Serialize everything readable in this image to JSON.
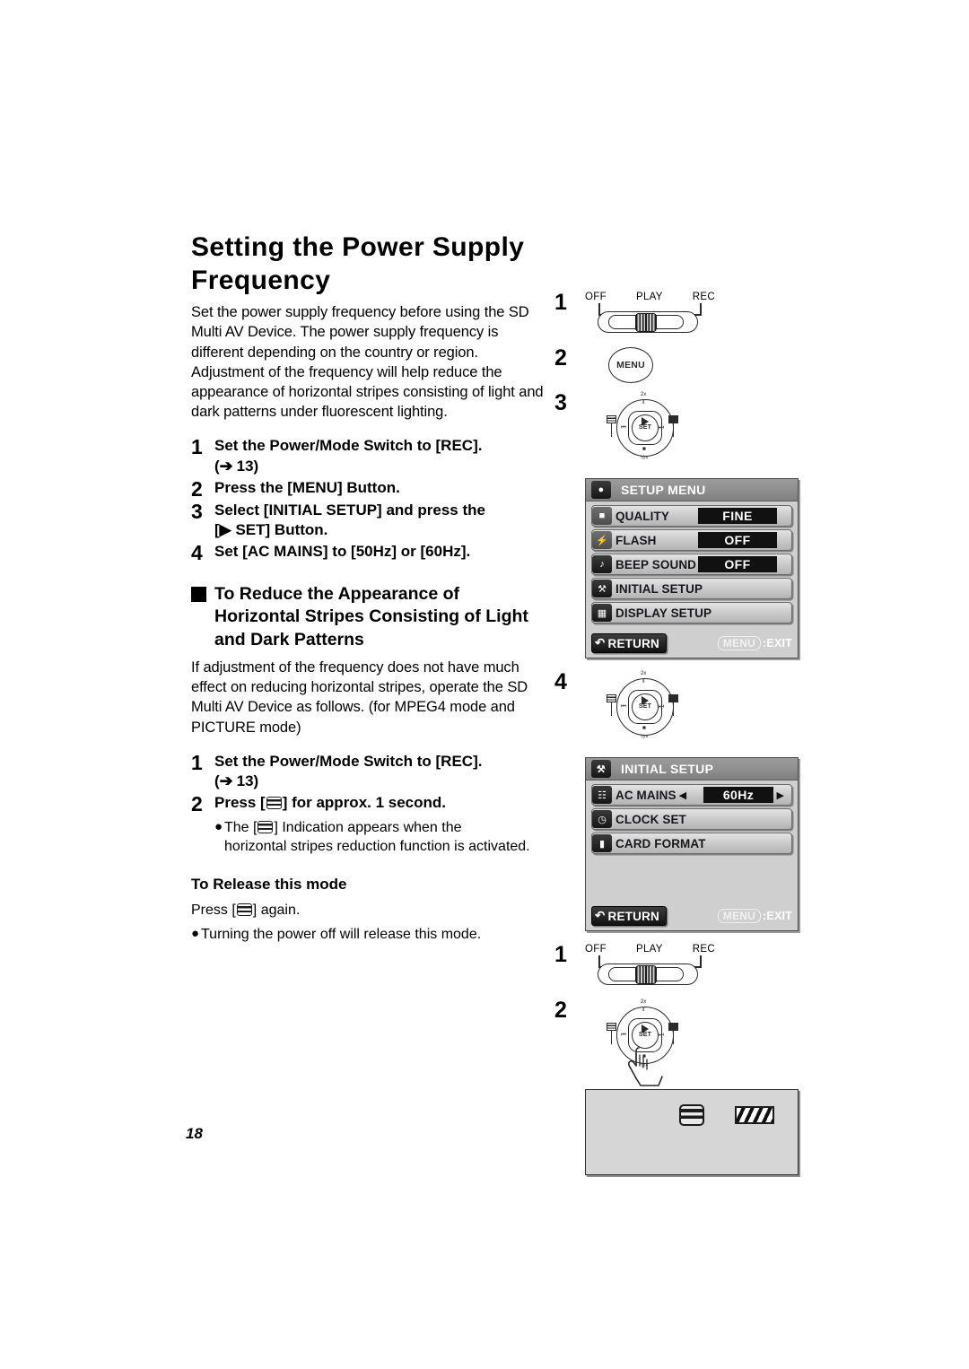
{
  "page": {
    "number": "18"
  },
  "article": {
    "title_line1": "Setting the Power Supply",
    "title_line2": "Frequency",
    "intro": "Set the power supply frequency before using the SD Multi AV Device. The power supply frequency is different depending on the country or region. Adjustment of the frequency will help reduce the appearance of horizontal stripes consisting of light and dark patterns under fluorescent lighting.",
    "steps": [
      {
        "num": "1",
        "text": "Set the Power/Mode Switch to [REC].",
        "sub": "( 13)"
      },
      {
        "num": "2",
        "text": "Press the [MENU] Button.",
        "sub": ""
      },
      {
        "num": "3",
        "text": "Select [INITIAL SETUP] and press the",
        "sub": "[   SET] Button."
      },
      {
        "num": "4",
        "text": "Set [AC MAINS] to [50Hz] or [60Hz].",
        "sub": ""
      }
    ]
  },
  "section": {
    "heading_line1": "To Reduce the Appearance of",
    "heading_line2": "Horizontal Stripes Consisting of Light",
    "heading_line3": "and Dark Patterns",
    "body": "If adjustment of the frequency does not have much effect on reducing horizontal stripes, operate the SD Multi AV Device as follows. (for MPEG4 mode and PICTURE mode)",
    "steps": [
      {
        "num": "1",
        "text": "Set the Power/Mode Switch to [REC].",
        "sub": "( 13)"
      },
      {
        "num": "2",
        "text_before": "Press [",
        "text_after": "] for approx. 1 second.",
        "sub": ""
      }
    ],
    "note_before": "The [",
    "note_after": "]  Indication appears when the",
    "note_line2": "horizontal stripes reduction function is activated.",
    "release_heading": "To Release this mode",
    "release_before": "Press [",
    "release_after": "] again.",
    "release_bullet": "Turning the power off will release this mode."
  },
  "illustrations": {
    "switch": {
      "labels": [
        "OFF",
        "PLAY",
        "REC"
      ]
    },
    "menu_button_label": "MENU",
    "dial": {
      "set_label": "SET",
      "top_label": "2x",
      "bottom_label": "½×",
      "pause_glyph": "‖",
      "stop_glyph": "■",
      "prev_glyph": "⏮",
      "next_glyph": "⏭"
    },
    "step_numbers_col1": [
      "1",
      "2",
      "3",
      "4"
    ],
    "step_numbers_col2": [
      "1",
      "2"
    ]
  },
  "setup_menu": {
    "title": "SETUP MENU",
    "title_icon": "camera-icon",
    "rows": [
      {
        "icon": "quality-icon",
        "label": "QUALITY",
        "value": "FINE"
      },
      {
        "icon": "flash-icon",
        "label": "FLASH",
        "value": "OFF"
      },
      {
        "icon": "beep-icon",
        "label": "BEEP SOUND",
        "value": "OFF"
      },
      {
        "icon": "initial-setup-icon",
        "label": "INITIAL SETUP",
        "value": ""
      },
      {
        "icon": "display-setup-icon",
        "label": "DISPLAY SETUP",
        "value": ""
      }
    ],
    "return_label": "RETURN",
    "exit_key": "MENU",
    "exit_label": ":EXIT"
  },
  "initial_setup_menu": {
    "title": "INITIAL SETUP",
    "title_icon": "initial-setup-icon",
    "rows": [
      {
        "icon": "ac-mains-icon",
        "label": "AC MAINS",
        "value": "60Hz",
        "arrows": true
      },
      {
        "icon": "clock-icon",
        "label": "CLOCK SET",
        "value": "",
        "arrows": false
      },
      {
        "icon": "card-format-icon",
        "label": "CARD FORMAT",
        "value": "",
        "arrows": false
      }
    ],
    "return_label": "RETURN",
    "exit_key": "MENU",
    "exit_label": ":EXIT"
  },
  "screen_indicator": {
    "stripe_icon": "horizontal-stripes-icon",
    "battery_icon": "battery-full-icon"
  },
  "colors": {
    "osd_bg": "#cfcfcf",
    "osd_title_bg": "#8e8e8e",
    "osd_value_bg": "#111111",
    "screen_bg": "#d6d6d6",
    "text": "#000000"
  }
}
